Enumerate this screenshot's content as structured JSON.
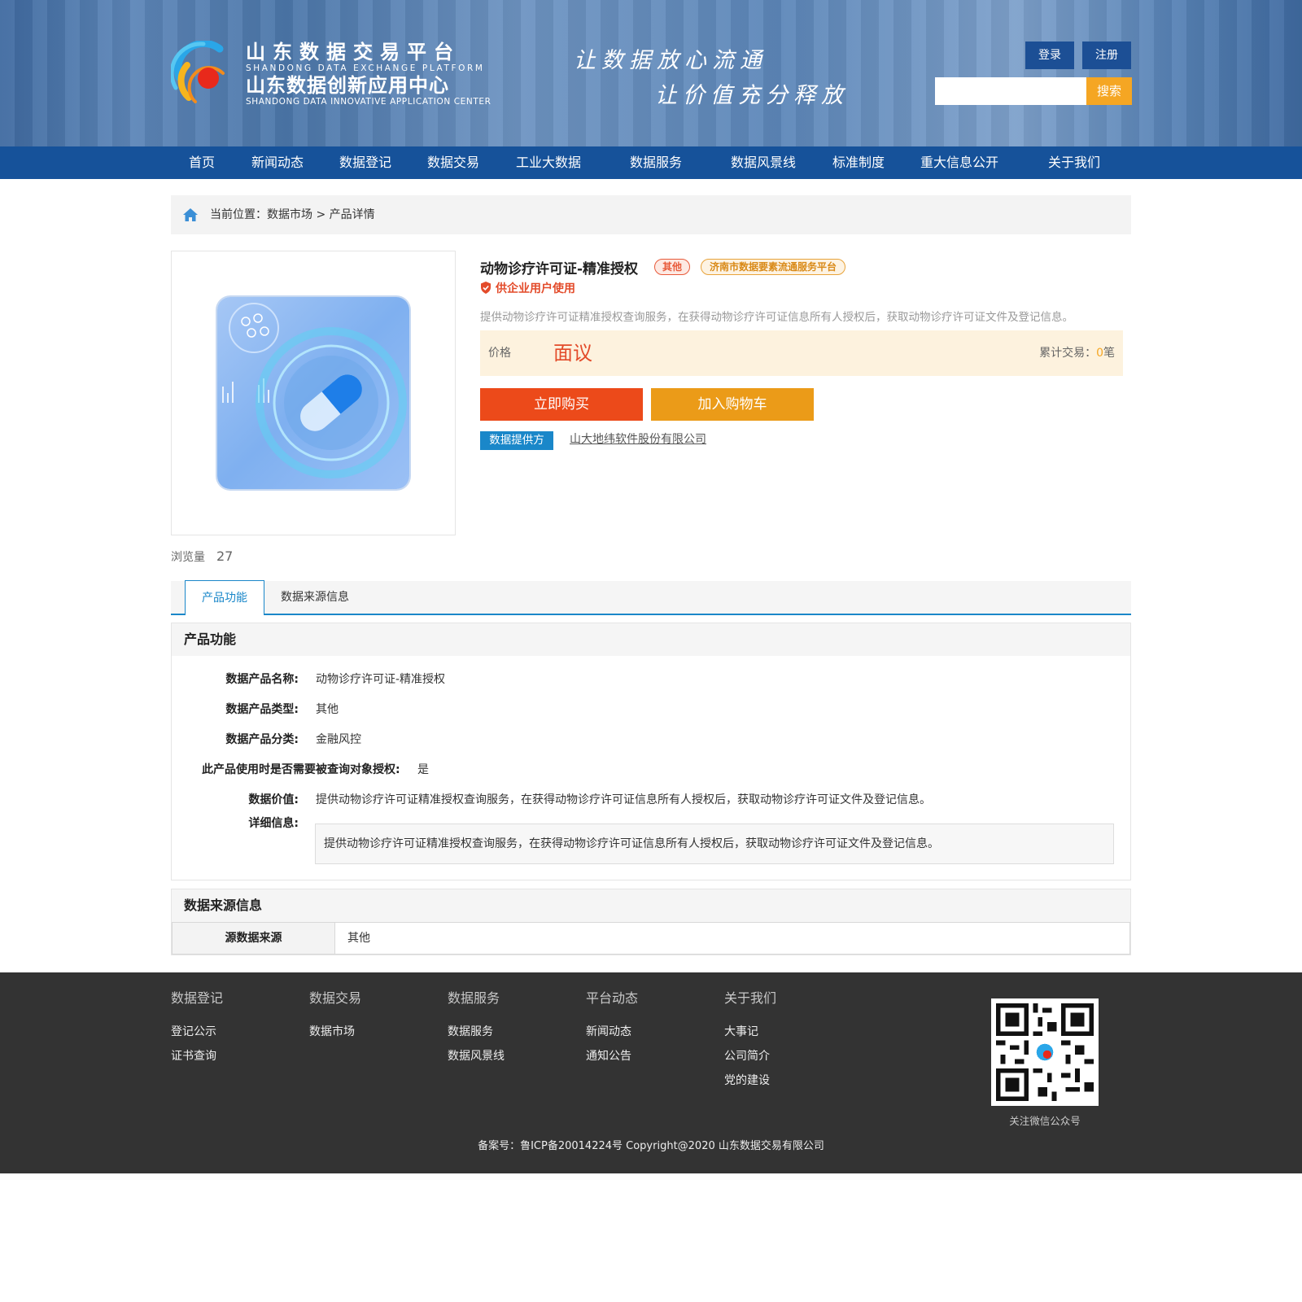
{
  "header": {
    "brand_cn_1": "山东数据交易平台",
    "brand_en_1": "SHANDONG DATA EXCHANGE PLATFORM",
    "brand_cn_2": "山东数据创新应用中心",
    "brand_en_2": "SHANDONG DATA INNOVATIVE APPLICATION CENTER",
    "slogan_1": "让数据放心流通",
    "slogan_2": "让价值充分释放",
    "login_label": "登录",
    "register_label": "注册",
    "search_placeholder": "",
    "search_label": "搜索",
    "logo_icon": "platform-logo-icon"
  },
  "nav": {
    "items": [
      "首页",
      "新闻动态",
      "数据登记",
      "数据交易",
      "工业大数据",
      "数据服务",
      "数据风景线",
      "标准制度",
      "重大信息公开",
      "关于我们"
    ]
  },
  "breadcrumb": {
    "prefix": "当前位置：",
    "market": "数据市场",
    "sep": " > ",
    "current": "产品详情",
    "home_icon": "home-icon"
  },
  "product": {
    "title": "动物诊疗许可证-精准授权",
    "tag_type": "其他",
    "tag_platform": "济南市数据要素流通服务平台",
    "usage": "供企业用户使用",
    "description": "提供动物诊疗许可证精准授权查询服务，在获得动物诊疗许可证信息所有人授权后，获取动物诊疗许可证文件及登记信息。",
    "price_label": "价格",
    "price_value": "面议",
    "trade_label": "累计交易：",
    "trade_count": "0",
    "trade_unit": "笔",
    "buy_label": "立即购买",
    "cart_label": "加入购物车",
    "provider_label": "数据提供方",
    "provider_name": "山大地纬软件股份有限公司",
    "views_label": "浏览量",
    "views_count": "27"
  },
  "tabs": {
    "active": "产品功能",
    "second": "数据来源信息"
  },
  "features": {
    "heading": "产品功能",
    "rows": [
      {
        "key": "数据产品名称:",
        "value": "动物诊疗许可证-精准授权"
      },
      {
        "key": "数据产品类型:",
        "value": "其他"
      },
      {
        "key": "数据产品分类:",
        "value": "金融风控"
      },
      {
        "key": "此产品使用时是否需要被查询对象授权:",
        "value": "是"
      },
      {
        "key": "数据价值:",
        "value": "提供动物诊疗许可证精准授权查询服务，在获得动物诊疗许可证信息所有人授权后，获取动物诊疗许可证文件及登记信息。"
      },
      {
        "key": "详细信息:",
        "value": "提供动物诊疗许可证精准授权查询服务，在获得动物诊疗许可证信息所有人授权后，获取动物诊疗许可证文件及登记信息。"
      }
    ]
  },
  "source": {
    "heading": "数据来源信息",
    "key": "源数据来源",
    "value": "其他"
  },
  "footer": {
    "columns": [
      {
        "heading": "数据登记",
        "items": [
          "登记公示",
          "证书查询"
        ]
      },
      {
        "heading": "数据交易",
        "items": [
          "数据市场"
        ]
      },
      {
        "heading": "数据服务",
        "items": [
          "数据服务",
          "数据风景线"
        ]
      },
      {
        "heading": "平台动态",
        "items": [
          "新闻动态",
          "通知公告"
        ]
      },
      {
        "heading": "关于我们",
        "items": [
          "大事记",
          "公司简介",
          "党的建设"
        ]
      }
    ],
    "qr_caption": "关注微信公众号",
    "copyright": "备案号：鲁ICP备20014224号 Copyright@2020 山东数据交易有限公司"
  },
  "colors": {
    "nav_bg": "#16529a",
    "accent_blue": "#1a87c9",
    "buy_red": "#ec4a1a",
    "cart_orange": "#eb9b18",
    "price_bg": "#fdf2de",
    "footer_bg": "#333333"
  }
}
